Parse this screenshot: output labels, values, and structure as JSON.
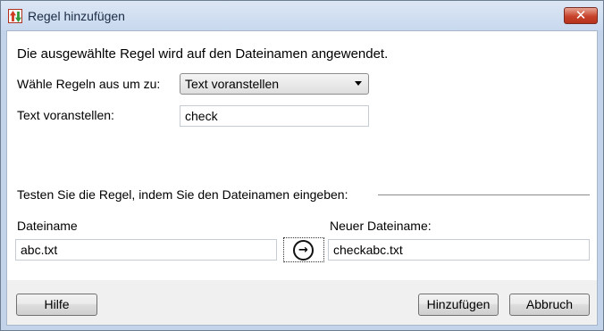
{
  "window": {
    "title": "Regel hinzufügen",
    "close_symbol": "✕"
  },
  "icons": {
    "app": "rename-rule-icon",
    "close": "close-icon",
    "dropdown": "chevron-down-icon",
    "apply": "arrow-right-circle-icon"
  },
  "main": {
    "intro": "Die ausgewählte Regel wird auf den Dateinamen angewendet.",
    "rule_label": "Wähle Regeln aus um zu:",
    "rule_value": "Text voranstellen",
    "text_label": "Text voranstellen:",
    "text_value": "check"
  },
  "test": {
    "heading": "Testen Sie die Regel, indem Sie den Dateinamen eingeben:",
    "filename_label": "Dateiname",
    "filename_value": "abc.txt",
    "new_filename_label": "Neuer Dateiname:",
    "new_filename_value": "checkabc.txt",
    "apply_symbol": "→"
  },
  "buttons": {
    "help": "Hilfe",
    "add": "Hinzufügen",
    "cancel": "Abbruch"
  }
}
